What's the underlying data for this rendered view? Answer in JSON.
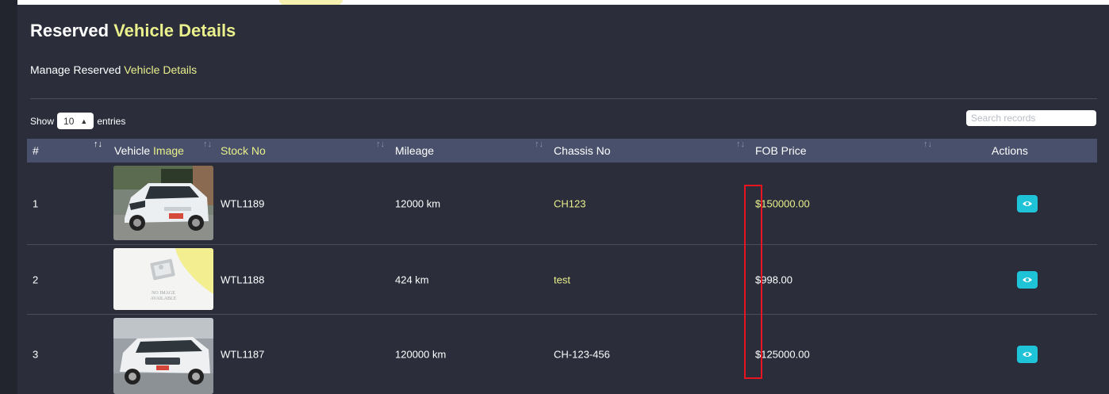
{
  "page": {
    "title_part1": "Reserved",
    "title_part2": "Vehicle Details",
    "subtitle_part1": "Manage Reserved",
    "subtitle_part2": "Vehicle Details"
  },
  "table_controls": {
    "show_label": "Show",
    "entries_value": "10",
    "entries_label": "entries",
    "search_placeholder": "Search records"
  },
  "table": {
    "columns": {
      "index": "#",
      "vehicle_image_part1": "Vehicle",
      "vehicle_image_part2": "Image",
      "stock_no": "Stock No",
      "mileage": "Mileage",
      "chassis_no": "Chassis No",
      "fob_price": "FOB Price",
      "actions": "Actions"
    },
    "rows": [
      {
        "index": "1",
        "image": "white-hatchback-photo",
        "stock_no": "WTL1189",
        "mileage": "12000 km",
        "chassis_no": "CH123",
        "fob_price": "$150000.00"
      },
      {
        "index": "2",
        "image": "no-image-placeholder",
        "image_text_line1": "NO IMAGE",
        "image_text_line2": "AVAILABLE",
        "stock_no": "WTL1188",
        "mileage": "424 km",
        "chassis_no": "test",
        "fob_price": "$998.00"
      },
      {
        "index": "3",
        "image": "white-wagon-photo",
        "stock_no": "WTL1187",
        "mileage": "120000 km",
        "chassis_no": "CH-123-456",
        "fob_price": "$125000.00"
      }
    ]
  },
  "icons": {
    "sort": "sort-arrows-icon",
    "entries_select": "up-down-caret-icon",
    "view": "eye-icon"
  },
  "colors": {
    "accent": "#e9f08c",
    "panel_background": "#2b2d3b",
    "header_background": "#48506b",
    "view_button": "#1fc3d8",
    "annotation_box": "#e8141f"
  }
}
